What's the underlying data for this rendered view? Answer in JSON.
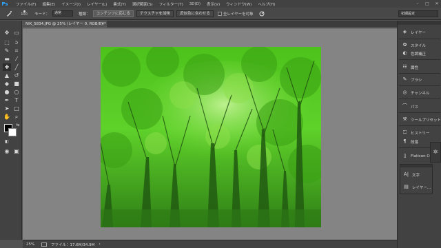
{
  "app": {
    "logo": "Ps"
  },
  "menu": [
    "ファイル(F)",
    "編集(E)",
    "イメージ(I)",
    "レイヤー(L)",
    "書式(Y)",
    "選択範囲(S)",
    "フィルター(T)",
    "3D(D)",
    "表示(V)",
    "ウィンドウ(W)",
    "ヘルプ(H)"
  ],
  "window_controls": {
    "minimize": "–",
    "maximize": "□",
    "close": "✕"
  },
  "options": {
    "brush_size": "100",
    "mode_label": "モード：",
    "mode_value": "通常",
    "type_label": "種類：",
    "content_aware": "コンテンツに応じる",
    "texture": "テクスチャを加味",
    "proximity": "近似色に合わせる",
    "all_layers": "全レイヤーを対象",
    "workspace": "初期設定"
  },
  "document": {
    "tab_title": "NIK_5834.JPG @ 25% (レイヤー 0, RGB/8) *",
    "close": "×"
  },
  "status": {
    "zoom": "25%",
    "file_info": "ファイル：17.6M/34.9M",
    "arrow": "›"
  },
  "panels": [
    {
      "icon": "layers-icon",
      "label": "レイヤー"
    },
    {
      "icon": "style-icon",
      "label": "スタイル"
    },
    {
      "icon": "adjustments-icon",
      "label": "色調補正"
    },
    {
      "icon": "properties-icon",
      "label": "属性"
    },
    {
      "icon": "brush-icon",
      "label": "ブラシ"
    },
    {
      "icon": "channels-icon",
      "label": "チャンネル"
    },
    {
      "icon": "paths-icon",
      "label": "パス"
    },
    {
      "icon": "tool-presets-icon",
      "label": "ツールプリセット"
    },
    {
      "icon": "history-icon",
      "label": "ヒストリー"
    },
    {
      "icon": "paragraph-icon",
      "label": "段落"
    },
    {
      "icon": "flaticon-icon",
      "label": "Flaticon CC"
    }
  ],
  "float_panel": [
    {
      "icon": "character-icon",
      "label": "文字"
    },
    {
      "icon": "layers-icon",
      "label": "レイヤー..."
    }
  ]
}
